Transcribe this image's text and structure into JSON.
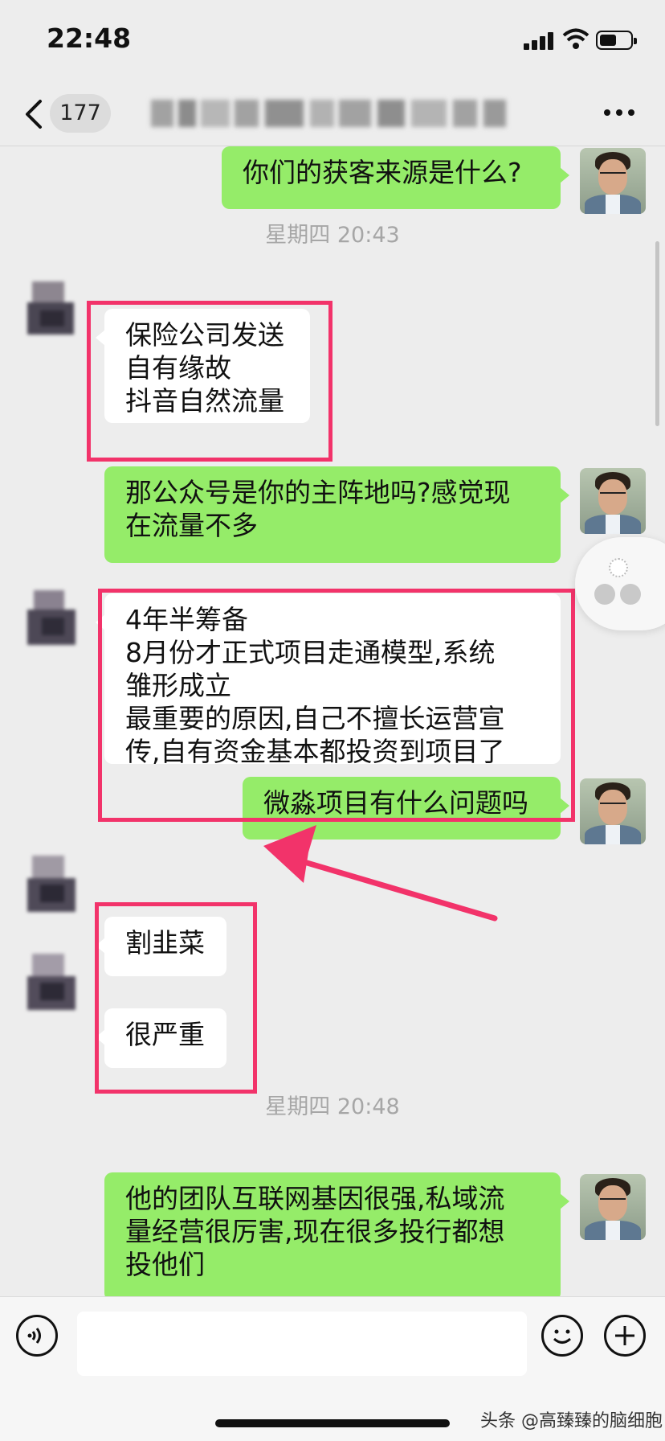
{
  "status_bar": {
    "time": "22:48"
  },
  "nav": {
    "unread_count": "177"
  },
  "messages": [
    {
      "side": "out",
      "text": "你们的获客来源是什么?"
    },
    {
      "type": "timestamp",
      "text": "星期四 20:43"
    },
    {
      "side": "in",
      "text": "保险公司发送\n自有缘故\n抖音自然流量"
    },
    {
      "side": "out",
      "text": "那公众号是你的主阵地吗?感觉现\n在流量不多"
    },
    {
      "side": "in",
      "text": "4年半筹备\n8月份才正式项目走通模型,系统\n雏形成立\n最重要的原因,自己不擅长运营宣\n传,自有资金基本都投资到项目了"
    },
    {
      "side": "out",
      "text": "微淼项目有什么问题吗"
    },
    {
      "side": "in",
      "text": "割韭菜"
    },
    {
      "side": "in",
      "text": "很严重"
    },
    {
      "type": "timestamp",
      "text": "星期四 20:48"
    },
    {
      "side": "out",
      "text": "他的团队互联网基因很强,私域流\n量经营很厉害,现在很多投行都想\n投他们"
    }
  ],
  "input": {
    "placeholder": ""
  },
  "watermark": "头条 @高臻臻的脑细胞",
  "colors": {
    "outgoing_bubble": "#95ec69",
    "incoming_bubble": "#ffffff",
    "highlight": "#f2336a",
    "background": "#ededed"
  }
}
